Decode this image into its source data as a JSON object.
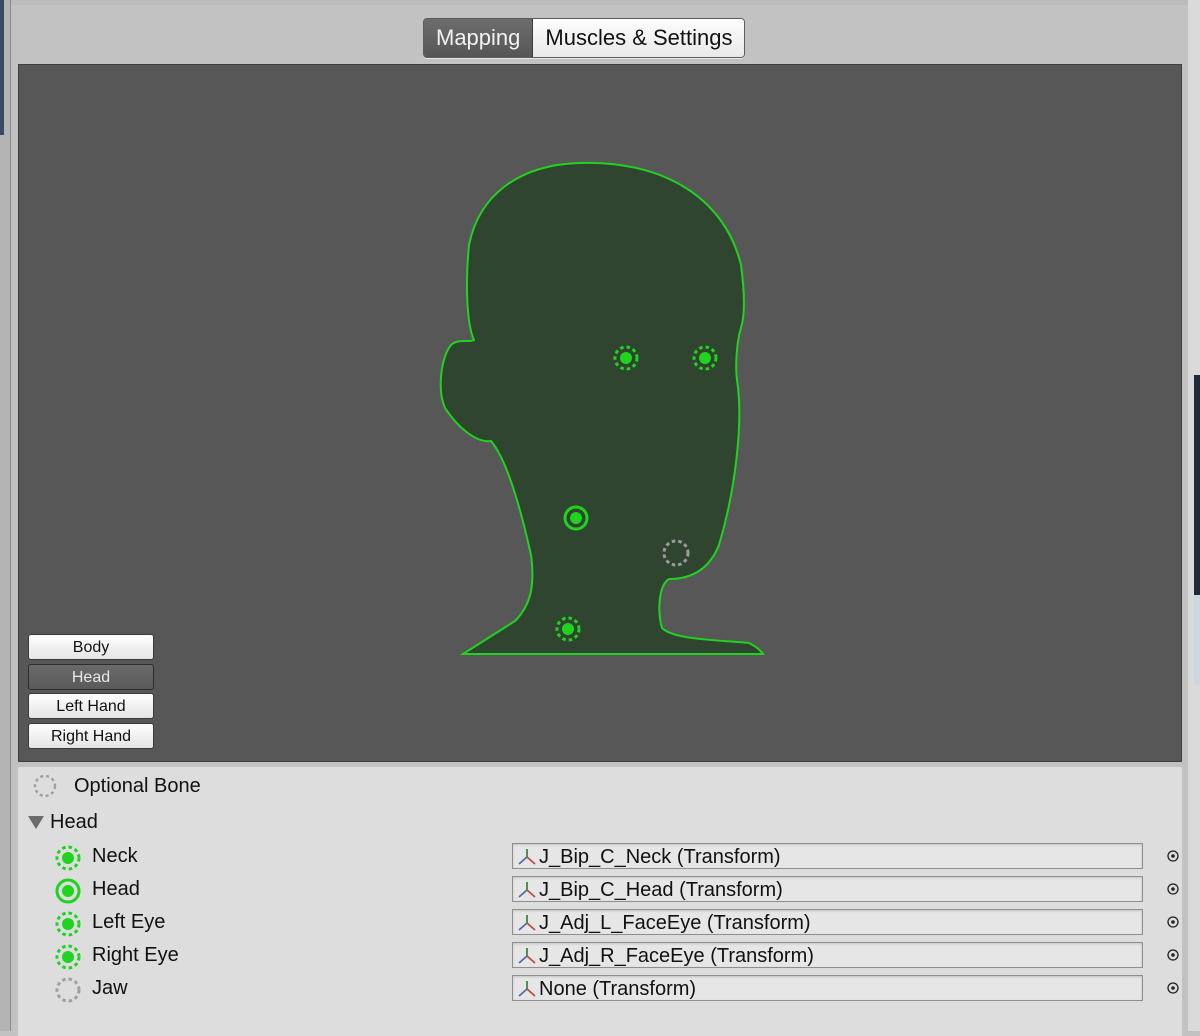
{
  "tabs": [
    {
      "label": "Mapping",
      "active": true
    },
    {
      "label": "Muscles & Settings",
      "active": false
    }
  ],
  "colors": {
    "accent_green": "#1fd31f",
    "head_fill": "#304530",
    "viewport_bg": "#575757",
    "optional_gray": "#a0a0a0"
  },
  "view_buttons": [
    {
      "label": "Body",
      "active": false
    },
    {
      "label": "Head",
      "active": true
    },
    {
      "label": "Left Hand",
      "active": false
    },
    {
      "label": "Right Hand",
      "active": false
    }
  ],
  "legend": {
    "label": "Optional Bone",
    "icon": "optional-bone-icon"
  },
  "section": {
    "label": "Head",
    "expanded": true
  },
  "bones": [
    {
      "name": "Neck",
      "value": "J_Bip_C_Neck (Transform)",
      "icon": "optional-mapped-icon"
    },
    {
      "name": "Head",
      "value": "J_Bip_C_Head (Transform)",
      "icon": "required-mapped-icon"
    },
    {
      "name": "Left Eye",
      "value": "J_Adj_L_FaceEye (Transform)",
      "icon": "optional-mapped-icon"
    },
    {
      "name": "Right Eye",
      "value": "J_Adj_R_FaceEye (Transform)",
      "icon": "optional-mapped-icon"
    },
    {
      "name": "Jaw",
      "value": "None (Transform)",
      "icon": "optional-unmapped-icon"
    }
  ]
}
